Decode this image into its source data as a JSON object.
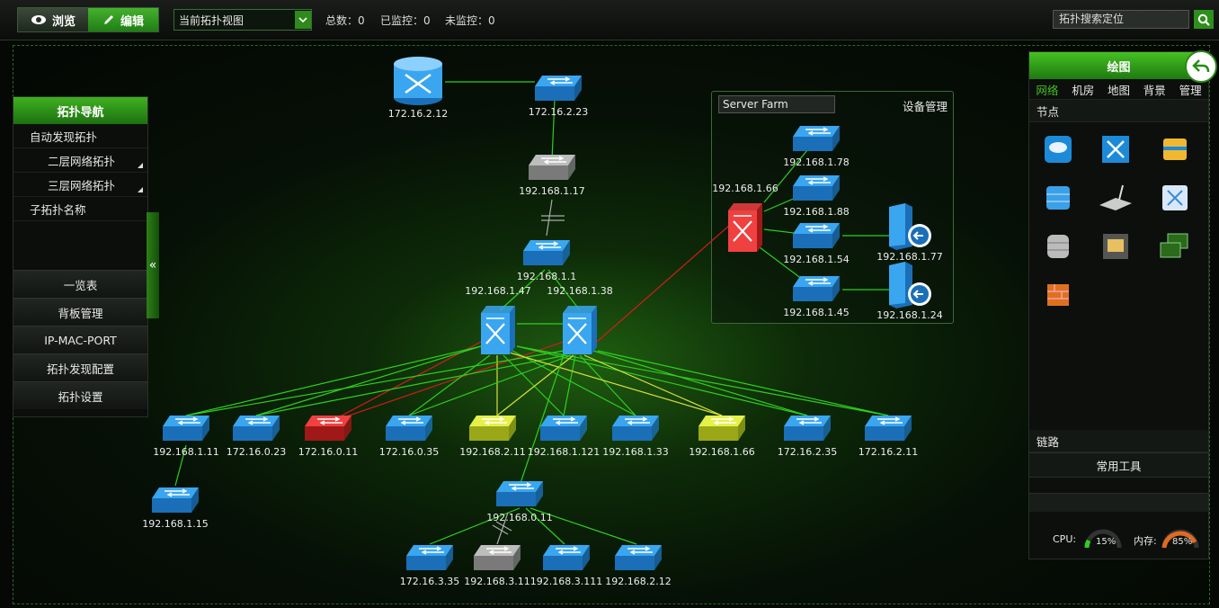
{
  "toolbar": {
    "browse_label": "浏览",
    "edit_label": "编辑",
    "view_select": "当前拓扑视图",
    "total": "总数：0",
    "monitored": "已监控：0",
    "unmonitored": "未监控：0",
    "search_placeholder": "拓扑搜索定位"
  },
  "leftnav": {
    "title": "拓扑导航",
    "items": [
      "自动发现拓扑",
      "二层网络拓扑",
      "三层网络拓扑",
      "子拓扑名称"
    ],
    "buttons": [
      "一览表",
      "背板管理",
      "IP-MAC-PORT",
      "拓扑发现配置",
      "拓扑设置"
    ],
    "collapse": "«"
  },
  "rightpanel": {
    "title": "绘图",
    "tabs": [
      "网络",
      "机房",
      "地图",
      "背景",
      "管理"
    ],
    "section_nodes": "节点",
    "section_links": "链路",
    "tools": "常用工具",
    "cpu_label": "CPU:",
    "cpu_value": "15%",
    "mem_label": "内存:",
    "mem_value": "85%"
  },
  "server_farm": {
    "input_value": "Server Farm",
    "manage_label": "设备管理"
  },
  "nodes": [
    {
      "ip": "172.16.2.12",
      "type": "router-cyl"
    },
    {
      "ip": "172.16.2.23",
      "type": "switch-blue"
    },
    {
      "ip": "192.168.1.17",
      "type": "switch-gray"
    },
    {
      "ip": "192.168.1.1",
      "type": "switch-blue"
    },
    {
      "ip": "192.168.1.47",
      "type": "l3-blue"
    },
    {
      "ip": "192.168.1.38",
      "type": "l3-blue"
    },
    {
      "ip": "192.168.1.11",
      "type": "switch-blue"
    },
    {
      "ip": "172.16.0.23",
      "type": "switch-blue"
    },
    {
      "ip": "172.16.0.11",
      "type": "switch-red"
    },
    {
      "ip": "172.16.0.35",
      "type": "switch-blue"
    },
    {
      "ip": "192.168.2.11",
      "type": "switch-yellow"
    },
    {
      "ip": "192.168.1.121",
      "type": "switch-blue"
    },
    {
      "ip": "192.168.1.33",
      "type": "switch-blue"
    },
    {
      "ip": "192.168.1.66",
      "type": "switch-yellow"
    },
    {
      "ip": "172.16.2.35",
      "type": "switch-blue"
    },
    {
      "ip": "172.16.2.11",
      "type": "switch-blue"
    },
    {
      "ip": "192.168.1.15",
      "type": "switch-blue"
    },
    {
      "ip": "192.168.0.11",
      "type": "switch-blue"
    },
    {
      "ip": "172.16.3.35",
      "type": "switch-blue"
    },
    {
      "ip": "192.168.3.11",
      "type": "switch-gray"
    },
    {
      "ip": "192.168.3.111",
      "type": "switch-blue"
    },
    {
      "ip": "192.168.2.12",
      "type": "switch-blue"
    },
    {
      "ip": "192.168.1.66",
      "type": "l3-red"
    },
    {
      "ip": "192.168.1.78",
      "type": "switch-blue"
    },
    {
      "ip": "192.168.1.88",
      "type": "switch-blue"
    },
    {
      "ip": "192.168.1.54",
      "type": "switch-blue"
    },
    {
      "ip": "192.168.1.45",
      "type": "switch-blue"
    },
    {
      "ip": "192.168.1.77",
      "type": "server"
    },
    {
      "ip": "192.168.1.24",
      "type": "server"
    }
  ],
  "palette_icons": [
    "cloud-icon",
    "l3-switch-icon",
    "router-icon",
    "firewall-stack-icon",
    "wireless-router-icon",
    "hub-icon",
    "storage-icon",
    "patch-panel-icon",
    "workstation-icon",
    "firewall-icon"
  ],
  "colors": {
    "accent": "#3fb020",
    "link_green": "#2fcf1f",
    "link_red": "#d01c1c",
    "link_yellow": "#d8e040"
  }
}
